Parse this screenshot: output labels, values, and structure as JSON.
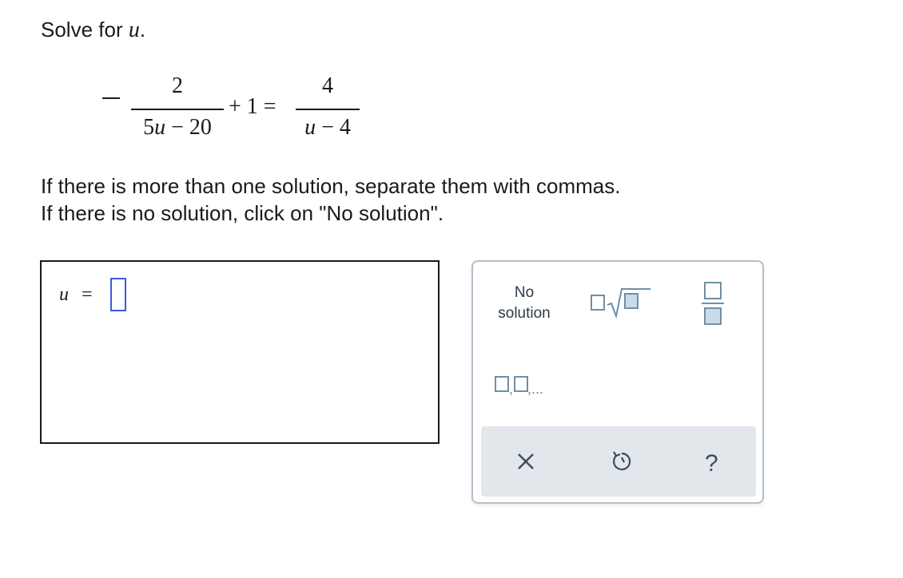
{
  "prompt": {
    "text": "Solve for",
    "variable": "u",
    "period": "."
  },
  "equation": {
    "left_numerator": "2",
    "left_denominator_coef": "5",
    "left_denominator_var": "u",
    "left_denominator_rest": "− 20",
    "middle": "+ 1 =",
    "right_numerator": "4",
    "right_denominator_var": "u",
    "right_denominator_rest": "− 4"
  },
  "instructions": {
    "line1": "If there is more than one solution, separate them with commas.",
    "line2": "If there is no solution, click on \"No solution\"."
  },
  "answer": {
    "variable": "u",
    "equals": "=",
    "value": ""
  },
  "palette": {
    "no_solution_line1": "No",
    "no_solution_line2": "solution",
    "tools": [
      "square-root-icon",
      "fraction-icon",
      "list-icon"
    ],
    "list_suffix": ",..."
  },
  "actions": [
    "clear-icon",
    "undo-icon",
    "help-icon"
  ],
  "colors": {
    "input_border": "#3b5bdb",
    "palette_accent": "#6f8fa6",
    "action_bar": "#e2e7ec"
  }
}
